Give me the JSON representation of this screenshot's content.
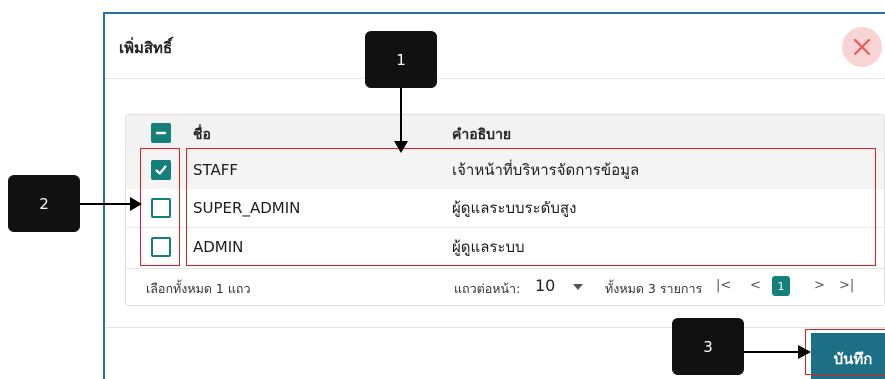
{
  "dialog": {
    "title": "เพิ่มสิทธิ์",
    "close_icon": "close-x"
  },
  "grid": {
    "columns": [
      "ชื่อ",
      "คำอธิบาย"
    ],
    "rows": [
      {
        "name": "STAFF",
        "description": "เจ้าหน้าที่บริหารจัดการข้อมูล",
        "checked": true
      },
      {
        "name": "SUPER_ADMIN",
        "description": "ผู้ดูแลระบบระดับสูง",
        "checked": false
      },
      {
        "name": "ADMIN",
        "description": "ผู้ดูแลระบบ",
        "checked": false
      }
    ],
    "select_all_state": "indeterminate"
  },
  "footer": {
    "selected_text": "เลือกทั้งหมด 1 แถว",
    "rows_per_page_label": "แถวต่อหน้า:",
    "rows_per_page_value": "10",
    "total_text": "ทั้งหมด 3 รายการ",
    "current_page": "1"
  },
  "actions": {
    "save_label": "บันทึก"
  },
  "annotations": {
    "callout_1": "1",
    "callout_2": "2",
    "callout_3": "3"
  },
  "colors": {
    "accent": "#14807a",
    "save_button": "#1d6f86",
    "highlight_red": "#e02020",
    "close_bg": "#f9d4d4",
    "close_x": "#e85c5c"
  }
}
